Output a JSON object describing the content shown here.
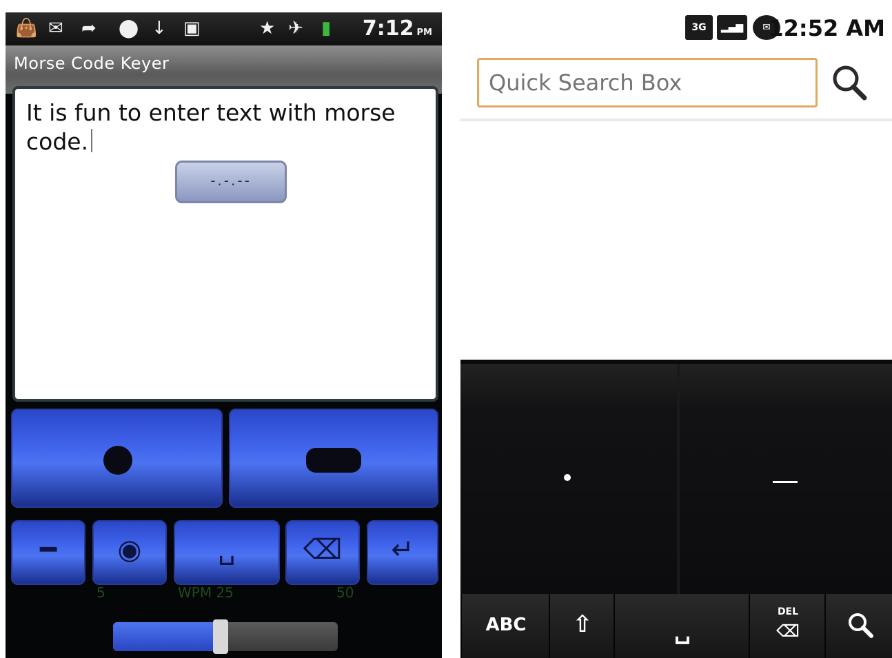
{
  "left": {
    "status": {
      "time": "7:12",
      "ampm": "PM",
      "icons": [
        "bag-icon",
        "mail-icon",
        "share-icon",
        "android-icon",
        "usb-icon",
        "image-icon",
        "bluetooth-icon",
        "airplane-icon",
        "battery-icon"
      ]
    },
    "title": "Morse Code Keyer",
    "editor": {
      "text": "It is fun to enter text with morse code."
    },
    "morse_preview": "-.-.--",
    "keys": {
      "dot_symbol": "dot",
      "dash_symbol": "dash",
      "function_keys": [
        "abc-icon",
        "settings-icon",
        "space-icon",
        "backspace-icon",
        "enter-icon"
      ]
    },
    "wpm": {
      "min": "5",
      "label": "WPM 25",
      "max": "50",
      "value_fraction": 0.48
    }
  },
  "right": {
    "status": {
      "network": "3G",
      "time": "12:52 AM",
      "icons": [
        "3g-icon",
        "signal-icon",
        "notification-icon"
      ]
    },
    "search": {
      "placeholder": "Quick Search Box"
    },
    "keyboard": {
      "dot_symbol": "•",
      "dash_symbol": "—",
      "abc_label": "ABC",
      "shift_label": "⇧",
      "space_label": "␣",
      "delete_label": "DEL",
      "search_label": "search"
    }
  },
  "colors": {
    "key_blue": "#3e62ea",
    "search_border": "#e2a860",
    "keyboard_bg": "#0a0a0c"
  }
}
